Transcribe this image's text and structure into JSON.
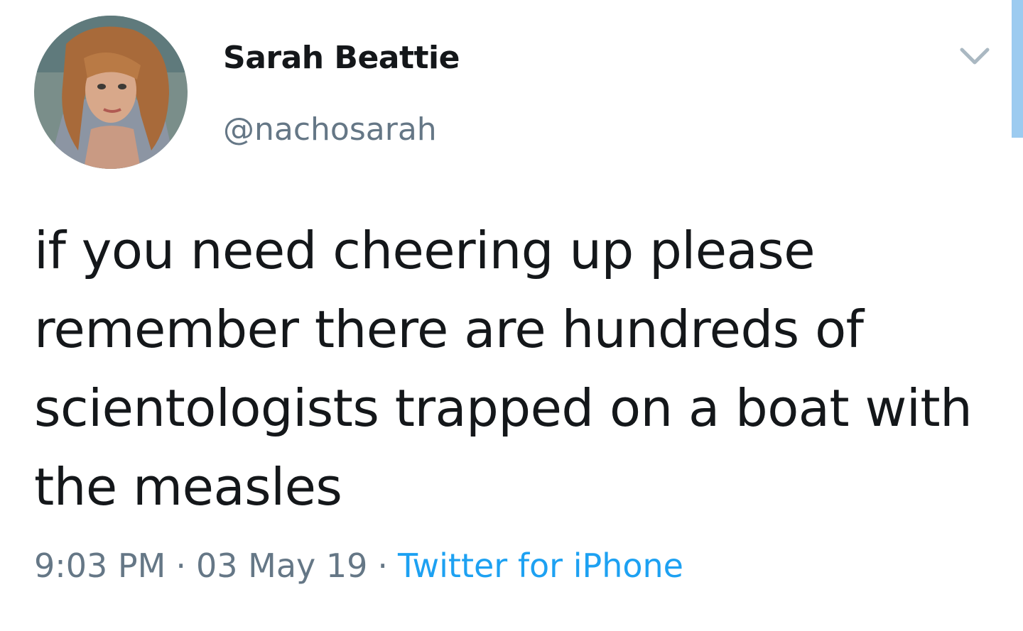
{
  "tweet": {
    "author": {
      "display_name": "Sarah Beattie",
      "handle": "@nachosarah"
    },
    "text": "if you need cheering up please remember there are hundreds of scientologists trapped on a boat with the measles",
    "time": "9:03 PM",
    "separator": "·",
    "date": "03 May 19",
    "source": "Twitter for iPhone"
  },
  "icons": {
    "avatar": "user-photo",
    "menu": "chevron-down-icon"
  },
  "colors": {
    "text": "#14171a",
    "secondary": "#657786",
    "link": "#1da1f2",
    "scrollbar": "#9ccbf0"
  }
}
